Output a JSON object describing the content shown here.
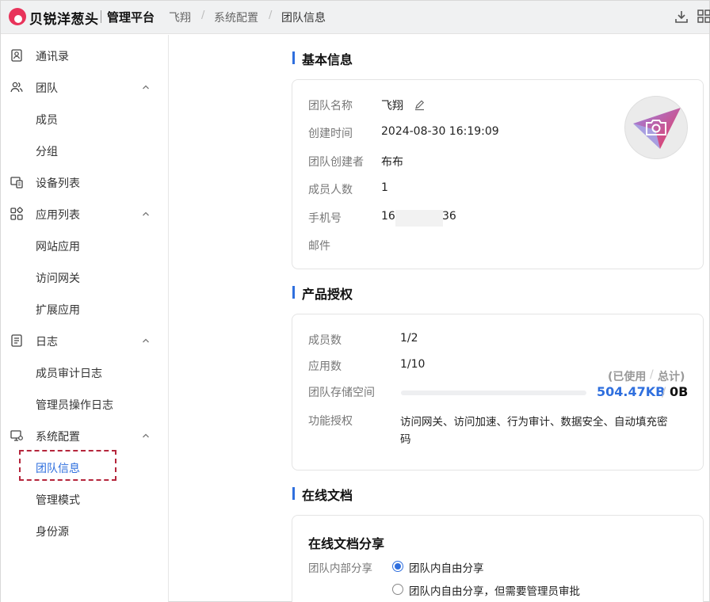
{
  "header": {
    "brand": "贝锐洋葱头",
    "platform": "管理平台",
    "breadcrumb": [
      "飞翔",
      "系统配置",
      "团队信息"
    ],
    "separator": "/"
  },
  "sidebar": {
    "items": [
      {
        "label": "通讯录",
        "icon": "contacts-icon"
      },
      {
        "label": "团队",
        "icon": "team-icon",
        "expandable": true
      },
      {
        "label": "成员"
      },
      {
        "label": "分组"
      },
      {
        "label": "设备列表",
        "icon": "devices-icon"
      },
      {
        "label": "应用列表",
        "icon": "apps-icon",
        "expandable": true
      },
      {
        "label": "网站应用"
      },
      {
        "label": "访问网关"
      },
      {
        "label": "扩展应用"
      },
      {
        "label": "日志",
        "icon": "log-icon",
        "expandable": true
      },
      {
        "label": "成员审计日志"
      },
      {
        "label": "管理员操作日志"
      },
      {
        "label": "系统配置",
        "icon": "settings-monitor-icon",
        "expandable": true
      },
      {
        "label": "团队信息",
        "active": true
      },
      {
        "label": "管理模式"
      },
      {
        "label": "身份源"
      }
    ]
  },
  "basic_info": {
    "title": "基本信息",
    "team_name_label": "团队名称",
    "team_name": "飞翔",
    "created_label": "创建时间",
    "created": "2024-08-30 16:19:09",
    "creator_label": "团队创建者",
    "creator": "布布",
    "members_label": "成员人数",
    "members": "1",
    "phone_label": "手机号",
    "phone_prefix": "16",
    "phone_suffix": "36",
    "email_label": "邮件"
  },
  "license": {
    "title": "产品授权",
    "members_label": "成员数",
    "members_value": "1/2",
    "apps_label": "应用数",
    "apps_value": "1/10",
    "storage_label": "团队存储空间",
    "storage_used_hint": "(已使用",
    "storage_total_hint": "总计)",
    "storage_hint_sep": "/",
    "storage_used": "504.47KB",
    "storage_sep": "/",
    "storage_total": "0B",
    "storage_fraction": 0,
    "features_label": "功能授权",
    "features_line1": "访问网关、访问加速、行为审计、数据安全、自动填充密",
    "features_line2": "码"
  },
  "docs": {
    "title": "在线文档",
    "card_title": "在线文档分享",
    "share_label": "团队内部分享",
    "options": [
      "团队内自由分享",
      "团队内自由分享，但需要管理员审批"
    ],
    "selected_index": 0
  },
  "colors": {
    "accent": "#2f6fde",
    "logo": "#e8335a",
    "highlight_border": "#b5263c"
  }
}
